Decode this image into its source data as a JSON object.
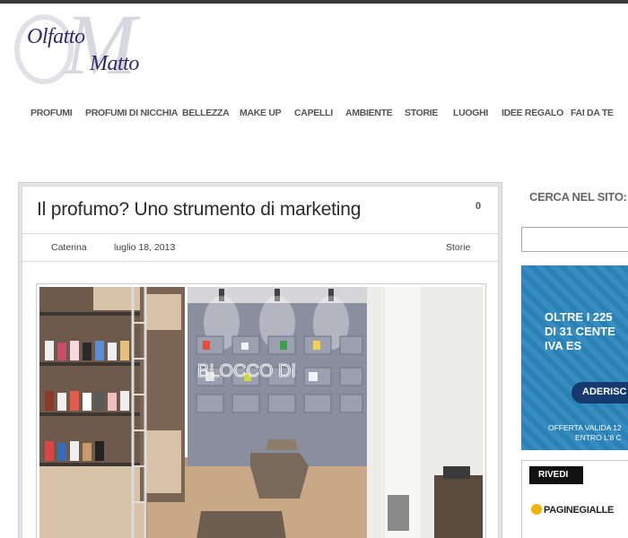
{
  "logo": {
    "line1": "Olfatto",
    "line2": "Matto"
  },
  "nav": [
    "PROFUMI",
    "PROFUMI DI NICCHIA",
    "BELLEZZA",
    "MAKE UP",
    "CAPELLI",
    "AMBIENTE",
    "STORIE",
    "LUOGHI",
    "IDEE REGALO",
    "FAI DA TE"
  ],
  "post": {
    "title": "Il profumo? Uno strumento di marketing",
    "comments": "0",
    "author": "Caterina",
    "date": "luglio 18, 2013",
    "category": "Storie",
    "photo_sign": "BLOCCO DI"
  },
  "sidebar": {
    "search_title": "CERCA NEL SITO:",
    "search_value": "",
    "ad1": {
      "line1": "OLTRE I 225",
      "line2": "DI 31 CENTE",
      "line3": "IVA ES",
      "cta": "ADERISC",
      "note1": "OFFERTA VALIDA 12",
      "note2": "ENTRO L'8 C"
    },
    "ad2": {
      "rivedi": "RIVEDI",
      "brand": "PAGINEGIALLE"
    }
  },
  "colors": {
    "ad_blue": "#2b86bd",
    "logo_ink": "#2c2a6a"
  }
}
